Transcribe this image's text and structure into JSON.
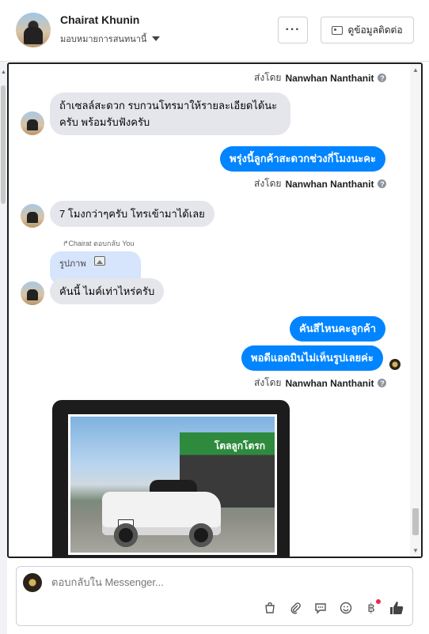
{
  "header": {
    "contact_name": "Chairat Khunin",
    "assign_label": "มอบหมายการสนทนานี้",
    "more_label": "···",
    "contact_info_label": "ดูข้อมูลติดต่อ"
  },
  "thread": {
    "sent_by_prefix": "ส่งโดย",
    "sent_by_name": "Nanwhan Nanthanit",
    "info_glyph": "?",
    "messages": [
      {
        "dir": "in",
        "text": "ถ้าเซลล์สะดวก รบกวนโทรมาให้รายละเอียดได้นะครับ พร้อมรับฟังครับ"
      },
      {
        "dir": "out",
        "text": "พรุ่งนี้ลูกค้าสะดวกช่วงกี่โมงนะคะ"
      },
      {
        "dir": "in",
        "text": "7 โมงกว่าๆครับ โทรเข้ามาได้เลย"
      },
      {
        "dir": "in",
        "text": "คันนี้ ไมค์เท่าไหร่ครับ"
      },
      {
        "dir": "out",
        "text": "คันสีไหนคะลูกค้า"
      },
      {
        "dir": "out",
        "text": "พอดีแอดมินไม่เห็นรูปเลยค่ะ"
      }
    ],
    "reply_note": "↱Chairat ตอบกลับ You",
    "reply_quote_label": "รูปภาพ",
    "photo_sign_text": "โตลลูกโตรก",
    "photo_plate_text": "9 ฐต"
  },
  "composer": {
    "placeholder": "ตอบกลับใน Messenger...",
    "icons": [
      "bag-icon",
      "attachment-icon",
      "saved-reply-icon",
      "emoji-icon",
      "baht-icon",
      "like-icon"
    ]
  },
  "colors": {
    "outgoing": "#0084ff",
    "incoming": "#e4e6eb",
    "reply_quote": "#d6e4fc"
  }
}
